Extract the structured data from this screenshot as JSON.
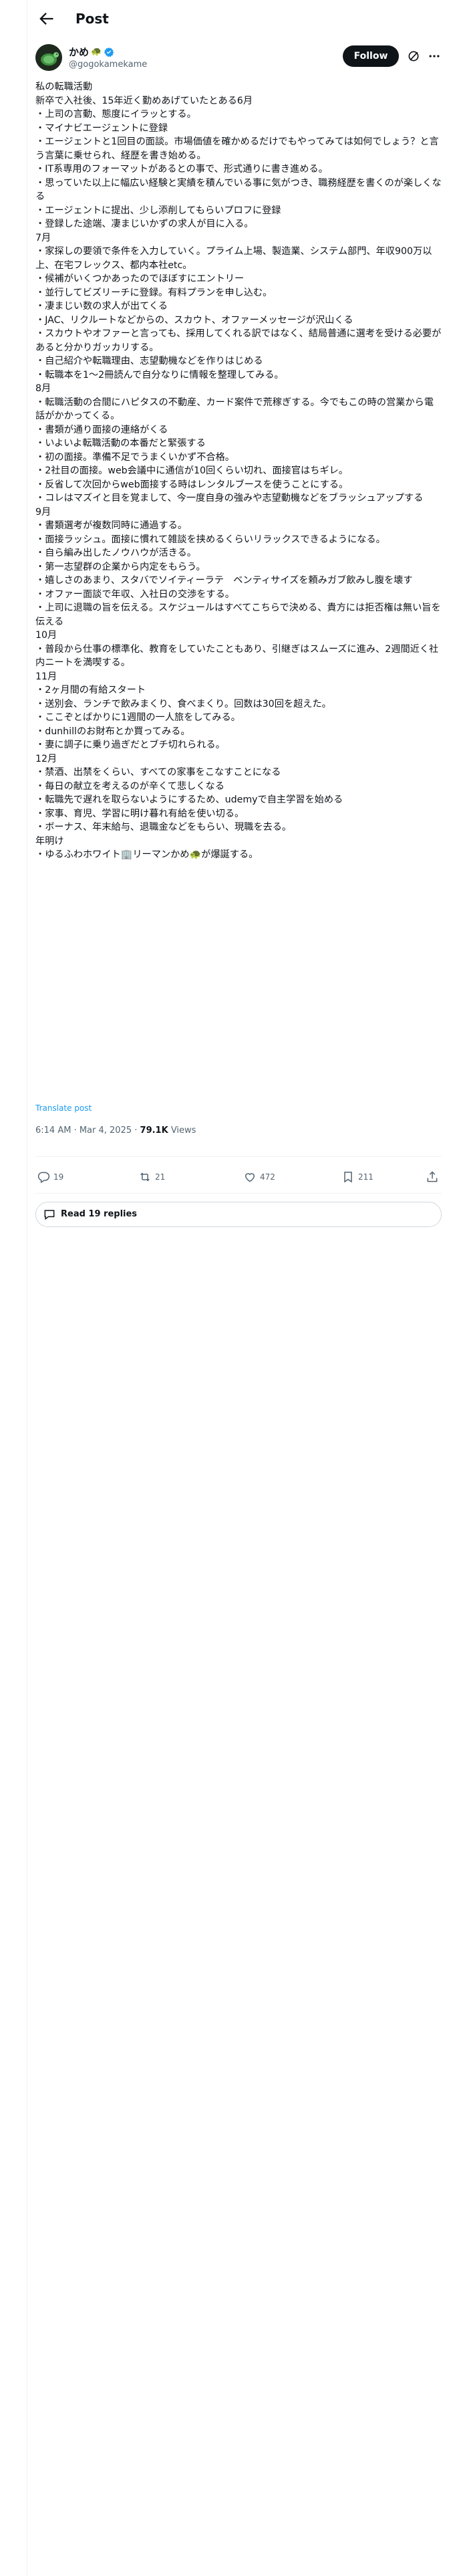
{
  "header": {
    "title": "Post"
  },
  "author": {
    "display_name": "かめ",
    "name_emoji": "🐢",
    "handle": "@gogokamekame",
    "follow_label": "Follow"
  },
  "post": {
    "lines": [
      "私の転職活動",
      "新卒で入社後、15年近く勤めあげていたとある6月",
      "・上司の言動、態度にイラッとする。",
      "・マイナビエージェントに登録",
      "・エージェントと1回目の面談。市場価値を確かめるだけでもやってみては如何でしょう？と言う言葉に乗せられ、経歴を書き始める。",
      "・IT系専用のフォーマットがあるとの事で、形式通りに書き進める。",
      "・思っていた以上に幅広い経験と実績を積んでいる事に気がつき、職務経歴を書くのが楽しくなる",
      "・エージェントに提出、少し添削してもらいプロフに登録",
      "・登録した途端、凄まじいかずの求人が目に入る。",
      "7月",
      "・家探しの要領で条件を入力していく。プライム上場、製造業、システム部門、年収900万以上、在宅フレックス、都内本社etc。",
      "・候補がいくつかあったのでほぼすにエントリー",
      "・並行してビズリーチに登録。有料プランを申し込む。",
      "・凄まじい数の求人が出てくる",
      "・JAC、リクルートなどからの、スカウト、オファーメッセージが沢山くる",
      "・スカウトやオファーと言っても、採用してくれる訳ではなく、結局普通に選考を受ける必要があると分かりガッカリする。",
      "・自己紹介や転職理由、志望動機などを作りはじめる",
      "・転職本を1〜2冊読んで自分なりに情報を整理してみる。",
      "8月",
      "・転職活動の合間にハピタスの不動産、カード案件で荒稼ぎする。今でもこの時の営業から電話がかかってくる。",
      "・書類が通り面接の連絡がくる",
      "・いよいよ転職活動の本番だと緊張する",
      "・初の面接。準備不足でうまくいかず不合格。",
      "・2社目の面接。web会議中に通信が10回くらい切れ、面接官はちギレ。",
      "・反省して次回からweb面接する時はレンタルブースを使うことにする。",
      "・コレはマズイと目を覚まして、今一度自身の強みや志望動機などをブラッシュアップする",
      "9月",
      "・書類選考が複数同時に通過する。",
      "・面接ラッシュ。面接に慣れて雑談を挟めるくらいリラックスできるようになる。",
      "・自ら編み出したノウハウが活きる。",
      "・第一志望群の企業から内定をもらう。",
      "・嬉しさのあまり、スタバでソイティーラテ　ベンティサイズを頼みガブ飲みし腹を壊す",
      "・オファー面談で年収、入社日の交渉をする。",
      "・上司に退職の旨を伝える。スケジュールはすべてこちらで決める、貴方には拒否権は無い旨を伝える",
      "10月",
      "・普段から仕事の標準化、教育をしていたこともあり、引継ぎはスムーズに進み、2週間近く社内ニートを満喫する。",
      "11月",
      "・2ヶ月間の有給スタート",
      "・送別会、ランチで飲みまくり、食べまくり。回数は30回を超えた。",
      "・ここぞとばかりに1週間の一人旅をしてみる。",
      "・dunhillのお財布とか買ってみる。",
      "・妻に調子に乗り過ぎだとブチ切れられる。",
      "12月",
      "・禁酒、出禁をくらい、すべての家事をこなすことになる",
      "・毎日の献立を考えるのが辛くて悲しくなる",
      "・転職先で遅れを取らないようにするため、udemyで自主学習を始める",
      "・家事、育児、学習に明け暮れ有給を使い切る。",
      "・ボーナス、年末給与、退職金などをもらい、現職を去る。",
      "年明け",
      "・ゆるふわホワイト🏢リーマンかめ🐢が爆誕する。"
    ]
  },
  "translate_label": "Translate post",
  "meta": {
    "time": "6:14 AM",
    "separator": " · ",
    "date": "Mar 4, 2025",
    "views_count": "79.1K",
    "views_label": " Views"
  },
  "actions": {
    "replies": "19",
    "reposts": "21",
    "likes": "472",
    "bookmarks": "211"
  },
  "read_replies_label": "Read 19 replies",
  "colors": {
    "accent": "#1d9bf0",
    "text_primary": "#0f1419",
    "text_secondary": "#536471",
    "divider": "#eff3f4",
    "follow_bg": "#0f1419"
  },
  "icons": [
    "back-arrow-icon",
    "verified-badge-icon",
    "grok-icon",
    "more-icon",
    "reply-icon",
    "repost-icon",
    "like-icon",
    "bookmark-icon",
    "share-icon",
    "speech-bubble-icon"
  ]
}
